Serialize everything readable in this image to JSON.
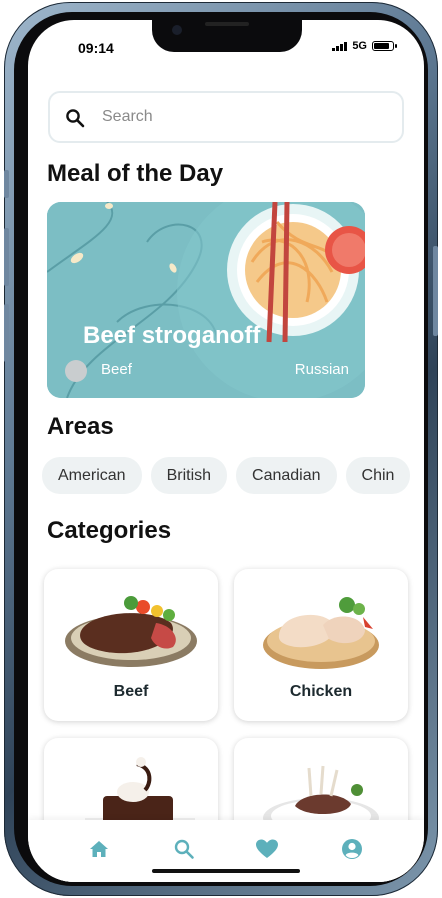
{
  "status_bar": {
    "time": "09:14",
    "network": "5G",
    "battery_level": 0.85
  },
  "search": {
    "placeholder": "Search",
    "value": ""
  },
  "meal_of_the_day": {
    "title": "Meal of the Day",
    "name": "Beef stroganoff",
    "category": "Beef",
    "area": "Russian"
  },
  "areas": {
    "title": "Areas",
    "items": [
      "American",
      "British",
      "Canadian",
      "Chin"
    ]
  },
  "categories": {
    "title": "Categories",
    "items": [
      {
        "label": "Beef",
        "icon": "beef-steak-image"
      },
      {
        "label": "Chicken",
        "icon": "chicken-image"
      },
      {
        "label": "",
        "icon": "dessert-image"
      },
      {
        "label": "",
        "icon": "lamb-image"
      }
    ]
  },
  "bottom_nav": {
    "items": [
      {
        "icon": "home-icon"
      },
      {
        "icon": "search-icon"
      },
      {
        "icon": "heart-icon"
      },
      {
        "icon": "profile-icon"
      }
    ]
  },
  "colors": {
    "accent": "#6fb7c0",
    "card_teal": "#7cbec4",
    "chip_bg": "#eef2f3",
    "nav_icon": "#5db0bb"
  }
}
